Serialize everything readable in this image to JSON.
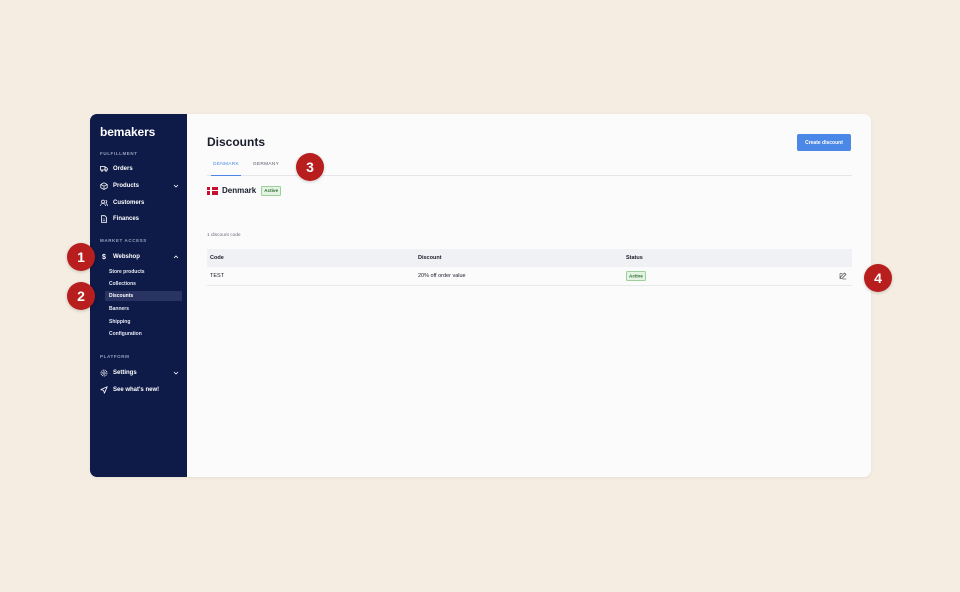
{
  "brand": "bemakers",
  "sidebar": {
    "sections": [
      {
        "label": "FULFILLMENT"
      },
      {
        "label": "MARKET ACCESS"
      },
      {
        "label": "PLATFORM"
      }
    ],
    "items": [
      {
        "label": "Orders",
        "icon": "truck-icon"
      },
      {
        "label": "Products",
        "icon": "box-icon"
      },
      {
        "label": "Customers",
        "icon": "users-icon"
      },
      {
        "label": "Finances",
        "icon": "document-icon"
      },
      {
        "label": "Webshop",
        "icon": "dollar-icon"
      },
      {
        "label": "Settings",
        "icon": "gear-icon"
      },
      {
        "label": "See what's new!",
        "icon": "rocket-icon"
      }
    ],
    "webshop_sub": [
      {
        "label": "Store products"
      },
      {
        "label": "Collections"
      },
      {
        "label": "Discounts",
        "active": true
      },
      {
        "label": "Banners"
      },
      {
        "label": "Shipping"
      },
      {
        "label": "Configuration"
      }
    ]
  },
  "main": {
    "title": "Discounts",
    "create_button": "Create discount",
    "tabs": [
      {
        "label": "DENMARK",
        "active": true
      },
      {
        "label": "GERMANY",
        "active": false
      }
    ],
    "country": {
      "name": "Denmark",
      "badge": "Active"
    },
    "count_text": "1 discount code",
    "table": {
      "headers": [
        "Code",
        "Discount",
        "Status"
      ],
      "rows": [
        {
          "code": "TEST",
          "discount": "20% off order value",
          "status": "Active"
        }
      ]
    }
  },
  "markers": [
    "1",
    "2",
    "3",
    "4"
  ],
  "colors": {
    "background": "#f5ede1",
    "sidebar": "#0e1a47",
    "accent": "#4a87e6",
    "marker": "#b81e1e",
    "badge_bg": "#e3f4e2"
  }
}
